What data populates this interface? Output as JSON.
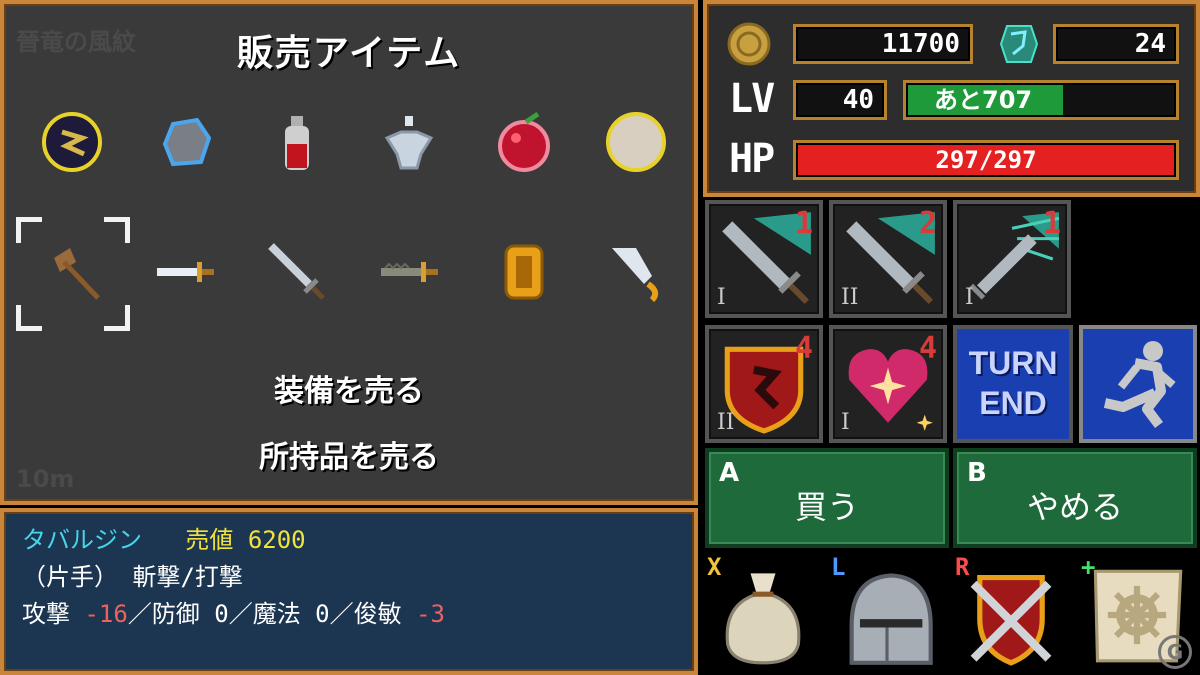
{
  "shop": {
    "bg_text": "晉竜の風紋",
    "bg_distance": "10m",
    "title": "販売アイテム",
    "options": [
      "装備を売る",
      "所持品を売る"
    ],
    "items_row1": [
      "dark-orb-icon",
      "stone-icon",
      "potion-bottle-icon",
      "silver-flask-icon",
      "apple-icon",
      "pearl-icon"
    ],
    "items_row2": [
      "axe-icon",
      "short-sword-icon",
      "long-sword-icon",
      "serrated-blade-icon",
      "gold-ring-icon",
      "curved-blade-icon"
    ],
    "selected_index": 6
  },
  "description": {
    "name": "タバルジン",
    "price_label": "売値",
    "price": "6200",
    "type": "（片手） 斬撃/打撃",
    "stats": [
      {
        "label": "攻撃",
        "value": "-16",
        "neg": true
      },
      {
        "label": "防御",
        "value": "0",
        "neg": false
      },
      {
        "label": "魔法",
        "value": "0",
        "neg": false
      },
      {
        "label": "俊敏",
        "value": "-3",
        "neg": true
      }
    ]
  },
  "status": {
    "gold": "11700",
    "gems": "24",
    "lv_label": "LV",
    "level": "40",
    "exp_text": "あと707",
    "exp_fraction": 0.59,
    "hp_label": "HP",
    "hp_text": "297/297",
    "hp_fraction": 1.0,
    "exp_color": "#1f9a3a",
    "hp_color": "#e52020"
  },
  "skills": [
    {
      "name": "sword-slash-skill",
      "num": "1",
      "rank": "I"
    },
    {
      "name": "sword-slash-skill-2",
      "num": "2",
      "rank": "II"
    },
    {
      "name": "sword-burst-skill",
      "num": "1",
      "rank": "I"
    },
    {
      "name": "shield-skill",
      "num": "4",
      "rank": "II"
    },
    {
      "name": "heart-skill",
      "num": "4",
      "rank": "I"
    }
  ],
  "turn_end": "TURN\nEND",
  "buttons": {
    "a_key": "A",
    "a_label": "買う",
    "b_key": "B",
    "b_label": "やめる"
  },
  "quick": [
    {
      "key": "X",
      "icon": "bag-icon",
      "color": "#f2c23a"
    },
    {
      "key": "L",
      "icon": "helmet-icon",
      "color": "#4a9aff"
    },
    {
      "key": "R",
      "icon": "crossed-swords-icon",
      "color": "#ff4a4a"
    },
    {
      "key": "+",
      "icon": "map-scroll-icon",
      "color": "#4adf6a"
    }
  ],
  "watermark": "G"
}
